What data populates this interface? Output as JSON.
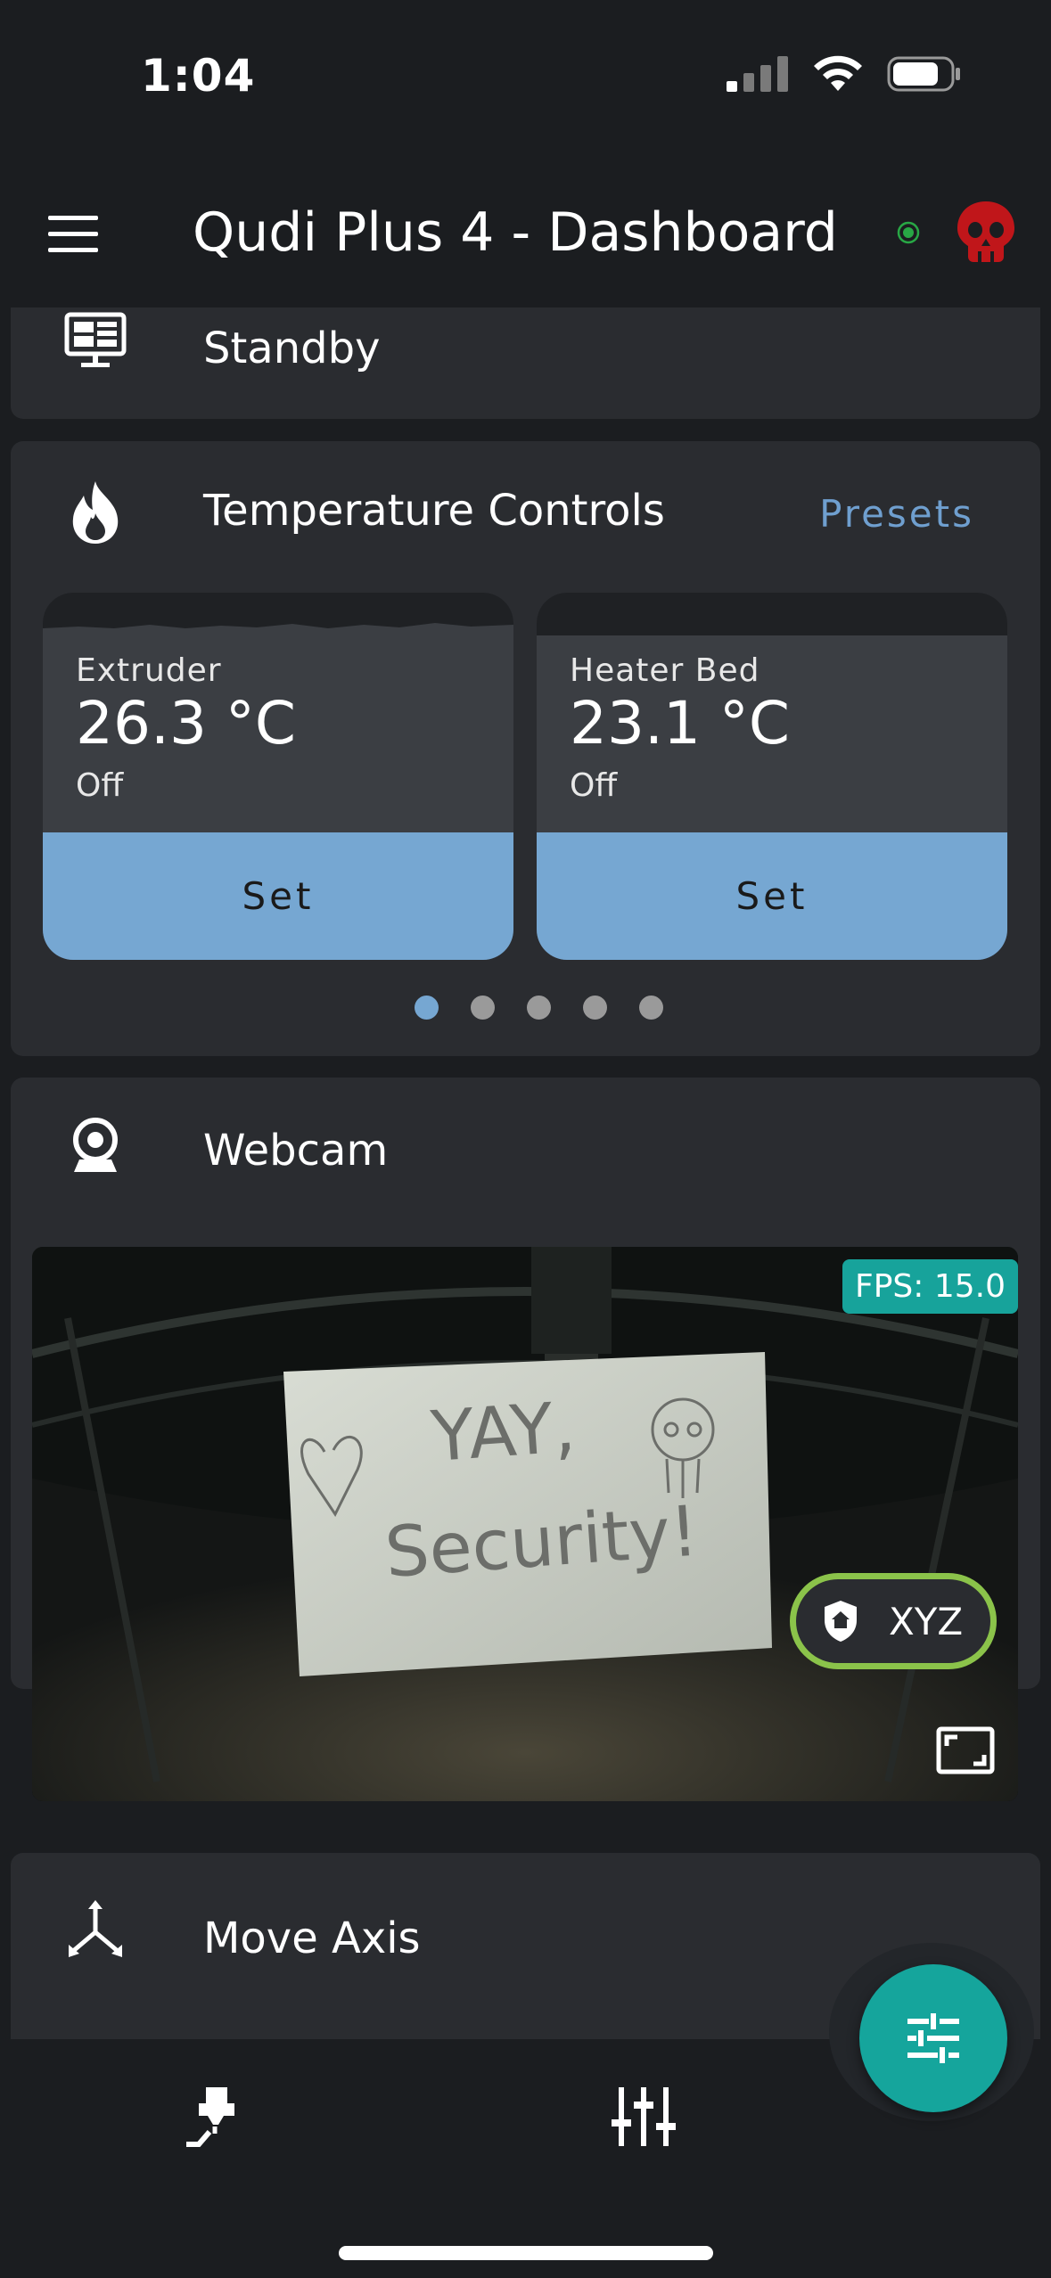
{
  "status_bar": {
    "time": "1:04"
  },
  "header": {
    "title": "Qudi Plus 4 - Dashboard",
    "connection_color": "#28a745",
    "alert_color": "#c0161a"
  },
  "standby_card": {
    "title": "Standby",
    "icon": "monitor-dashboard-icon"
  },
  "temperature_card": {
    "title": "Temperature Controls",
    "presets_label": "Presets",
    "icon": "fire-icon",
    "tiles": [
      {
        "label": "Extruder",
        "temperature": "26.3 °C",
        "state": "Off",
        "button": "Set"
      },
      {
        "label": "Heater Bed",
        "temperature": "23.1 °C",
        "state": "Off",
        "button": "Set"
      }
    ],
    "pager": {
      "count": 5,
      "active": 0
    }
  },
  "webcam_card": {
    "title": "Webcam",
    "icon": "webcam-icon",
    "fps_label": "FPS: 15.0",
    "sign_text_line1": "YAY,",
    "sign_text_line2": "Security!"
  },
  "move_axis_card": {
    "title": "Move Axis",
    "icon": "axis-arrows-icon",
    "home_button_label": "XYZ"
  },
  "colors": {
    "accent_blue": "#76a7d2",
    "teal": "#15a59c",
    "green_outline": "#8bc34a"
  }
}
